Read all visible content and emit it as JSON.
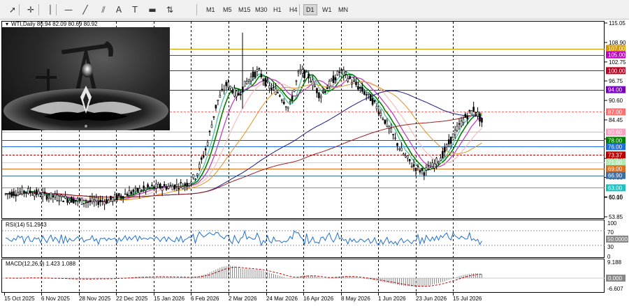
{
  "toolbar": {
    "tools": [
      {
        "name": "cursor-tool",
        "glyph": "➚"
      },
      {
        "name": "crosshair-tool",
        "glyph": "✛"
      },
      {
        "name": "vertical-line-tool",
        "glyph": "│"
      },
      {
        "name": "horizontal-line-tool",
        "glyph": "—"
      },
      {
        "name": "trendline-tool",
        "glyph": "╱"
      },
      {
        "name": "equidistant-channel-tool",
        "glyph": "⫽"
      },
      {
        "name": "text-tool",
        "glyph": "A"
      },
      {
        "name": "text-label-tool",
        "glyph": "T"
      },
      {
        "name": "rectangle-tool",
        "glyph": "▬"
      },
      {
        "name": "arrows-tool",
        "glyph": "⇅"
      }
    ],
    "timeframes": [
      "M1",
      "M5",
      "M15",
      "M30",
      "H1",
      "H4",
      "D1",
      "W1",
      "MN"
    ],
    "active_timeframe": "D1"
  },
  "chart": {
    "header": "WTI,Daily  80.94 82.09 80.69 80.92",
    "symbol": "WTI",
    "period": "Daily",
    "ohlc": {
      "open": 80.94,
      "high": 82.09,
      "low": 80.69,
      "close": 80.92
    },
    "price_axis_ticks": [
      "115.05",
      "108.90",
      "102.75",
      "96.75",
      "90.60",
      "84.45",
      "78.45",
      "72.30",
      "66.30",
      "60.15",
      "60.00",
      "53.85"
    ],
    "level_tags": [
      {
        "label": "107.00",
        "bg": "#d89a00",
        "value": 107.0
      },
      {
        "label": "105.00",
        "bg": "#c000c0",
        "value": 105.0
      },
      {
        "label": "100.00",
        "bg": "#c00020",
        "value": 100.0
      },
      {
        "label": "94.00",
        "bg": "#7a00c0",
        "value": 94.0
      },
      {
        "label": "87.00",
        "bg": "#ff7070",
        "value": 87.0
      },
      {
        "label": "80.60",
        "bg": "#ffa0c0",
        "value": 80.6
      },
      {
        "label": "78.00",
        "bg": "#008000",
        "value": 78.0
      },
      {
        "label": "76.00",
        "bg": "#1e6ed8",
        "value": 76.0
      },
      {
        "label": "73.37",
        "bg": "#c00000",
        "value": 73.37
      },
      {
        "label": "71.00",
        "bg": "#b0e8b0",
        "value": 71.0
      },
      {
        "label": "69.00",
        "bg": "#e07020",
        "value": 69.0
      },
      {
        "label": "66.90",
        "bg": "#3a6ea5",
        "value": 66.9
      },
      {
        "label": "63.00",
        "bg": "#20c0c0",
        "value": 63.0
      }
    ],
    "date_labels": [
      "15 Oct 2025",
      "6 Nov 2025",
      "28 Nov 2025",
      "22 Dec 2025",
      "15 Jan 2026",
      "6 Feb 2026",
      "2 Mar 2026",
      "24 Mar 2026",
      "16 Apr 2026",
      "8 May 2026",
      "1 Jun 2026",
      "23 Jun 2026",
      "15 Jul 2026"
    ]
  },
  "rsi": {
    "header": "RSI(14) 51.2943",
    "period": 14,
    "value": 51.2943,
    "ticks": [
      "100",
      "70",
      "30",
      "0"
    ],
    "current_tag": "50.0000"
  },
  "macd": {
    "header": "MACD(12,26,9) 1.423 1.088",
    "params": [
      12,
      26,
      9
    ],
    "main": 1.423,
    "signal": 1.088,
    "ticks": [
      "9.188",
      "-6.607"
    ],
    "current_tag": "0.000"
  },
  "colors": {
    "bull_candle": "#ffffff",
    "bear_candle": "#000000",
    "rsi_line": "#1e6ed8",
    "macd_signal": "#c00000",
    "tag_text": "#ffffff"
  }
}
